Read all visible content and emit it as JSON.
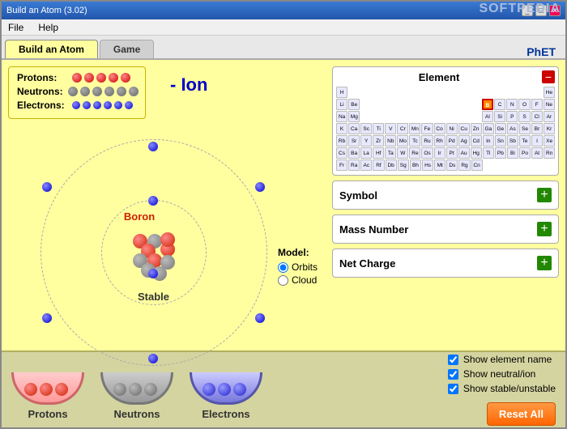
{
  "window": {
    "title": "Build an Atom (3.02)",
    "menu": [
      "File",
      "Help"
    ]
  },
  "tabs": [
    {
      "label": "Build an Atom",
      "active": true
    },
    {
      "label": "Game",
      "active": false
    }
  ],
  "phet_label": "PhET",
  "softpedia_label": "SOFTPEDIA",
  "counters": {
    "protons_label": "Protons:",
    "neutrons_label": "Neutrons:",
    "electrons_label": "Electrons:",
    "proton_count": 5,
    "neutron_count": 6,
    "electron_count": 6
  },
  "atom": {
    "ion_label": "- Ion",
    "element_name": "Boron",
    "stability": "Stable"
  },
  "model": {
    "label": "Model:",
    "options": [
      "Orbits",
      "Cloud"
    ],
    "selected": "Orbits"
  },
  "right_panel": {
    "element_section": {
      "title": "Element",
      "minus_btn": "−"
    },
    "symbol_section": {
      "title": "Symbol",
      "plus_btn": "+"
    },
    "mass_number_section": {
      "title": "Mass Number",
      "plus_btn": "+"
    },
    "charge_section": {
      "title": "Net Charge",
      "plus_btn": "+"
    }
  },
  "bottom": {
    "protons_label": "Protons",
    "neutrons_label": "Neutrons",
    "electrons_label": "Electrons",
    "options": [
      {
        "label": "Show element name",
        "checked": true
      },
      {
        "label": "Show neutral/ion",
        "checked": true
      },
      {
        "label": "Show stable/unstable",
        "checked": true
      }
    ],
    "reset_btn": "Reset All"
  },
  "periodic_table": {
    "rows": [
      [
        "",
        "",
        "",
        "",
        "",
        "",
        "",
        "",
        "",
        "",
        "",
        "",
        "",
        "",
        "",
        "",
        "",
        "He"
      ],
      [
        "Li",
        "Be",
        "",
        "",
        "",
        "",
        "",
        "",
        "",
        "",
        "",
        "",
        "B",
        "C",
        "N",
        "O",
        "F",
        "Ne"
      ],
      [
        "Na",
        "Mg",
        "",
        "",
        "",
        "",
        "",
        "",
        "",
        "",
        "",
        "",
        "Al",
        "Si",
        "P",
        "S",
        "Cl",
        "Ar"
      ],
      [
        "K",
        "Ca",
        "Sc",
        "Ti",
        "V",
        "Cr",
        "Mn",
        "Fe",
        "Co",
        "Ni",
        "Cu",
        "Zn",
        "Ga",
        "Ge",
        "As",
        "Se",
        "Br",
        "Kr"
      ],
      [
        "Rb",
        "Sr",
        "Y",
        "Zr",
        "Nb",
        "Mo",
        "Tc",
        "Ru",
        "Rh",
        "Pd",
        "Ag",
        "Cd",
        "In",
        "Sn",
        "Sb",
        "Te",
        "I",
        "Xe"
      ],
      [
        "Cs",
        "Ba",
        "La",
        "Hf",
        "Ta",
        "W",
        "Re",
        "Os",
        "Ir",
        "Pt",
        "Au",
        "Hg",
        "Tl",
        "Pb",
        "Bi",
        "Po",
        "At",
        "Rn"
      ],
      [
        "Fr",
        "Ra",
        "Ac",
        "Rf",
        "Db",
        "Sg",
        "Bh",
        "Hs",
        "Mt",
        "Ds",
        "Rg",
        "Cn",
        "",
        "",
        "",
        "",
        "",
        ""
      ]
    ],
    "highlighted": "B"
  },
  "h_row": [
    "",
    "",
    "",
    "",
    "",
    "",
    "",
    "",
    "",
    "",
    "",
    "",
    "",
    "",
    "",
    "",
    "H",
    ""
  ]
}
